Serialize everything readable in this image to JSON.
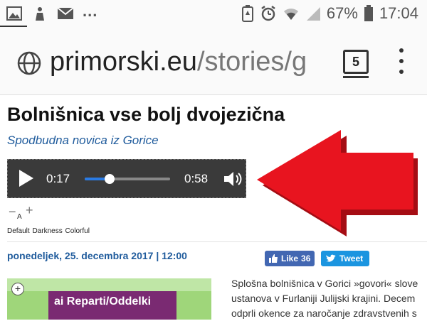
{
  "status_bar": {
    "battery_pct": "67%",
    "time": "17:04",
    "more": "..."
  },
  "browser": {
    "url_host": "primorski.eu",
    "url_path": "/stories/g",
    "tab_count": "5"
  },
  "article": {
    "title": "Bolnišnica vse bolj dvojezična",
    "subtitle": "Spodbudna novica iz Gorice",
    "date": "ponedeljek, 25. decembra 2017 | 12:00",
    "body_lines": [
      "Splošna bolnišnica v Gorici »govori« slove",
      "ustanova v Furlaniji Julijski krajini. Decem",
      "odprli okence za naročanje zdravstvenih s"
    ],
    "photo_sign_text": "ai Reparti/Oddelki"
  },
  "audio_player": {
    "current_time": "0:17",
    "total_time": "0:58",
    "progress": 0.29
  },
  "font_controls": {
    "minus": "−",
    "a": "A",
    "plus": "+"
  },
  "theme_options": "Default Darkness Colorful",
  "social": {
    "like_label": "Like",
    "like_count": "36",
    "tweet_label": "Tweet"
  },
  "colors": {
    "arrow": "#e8141f",
    "link_blue": "#1f5b9c",
    "facebook": "#4267b2",
    "twitter": "#1b95e0"
  }
}
